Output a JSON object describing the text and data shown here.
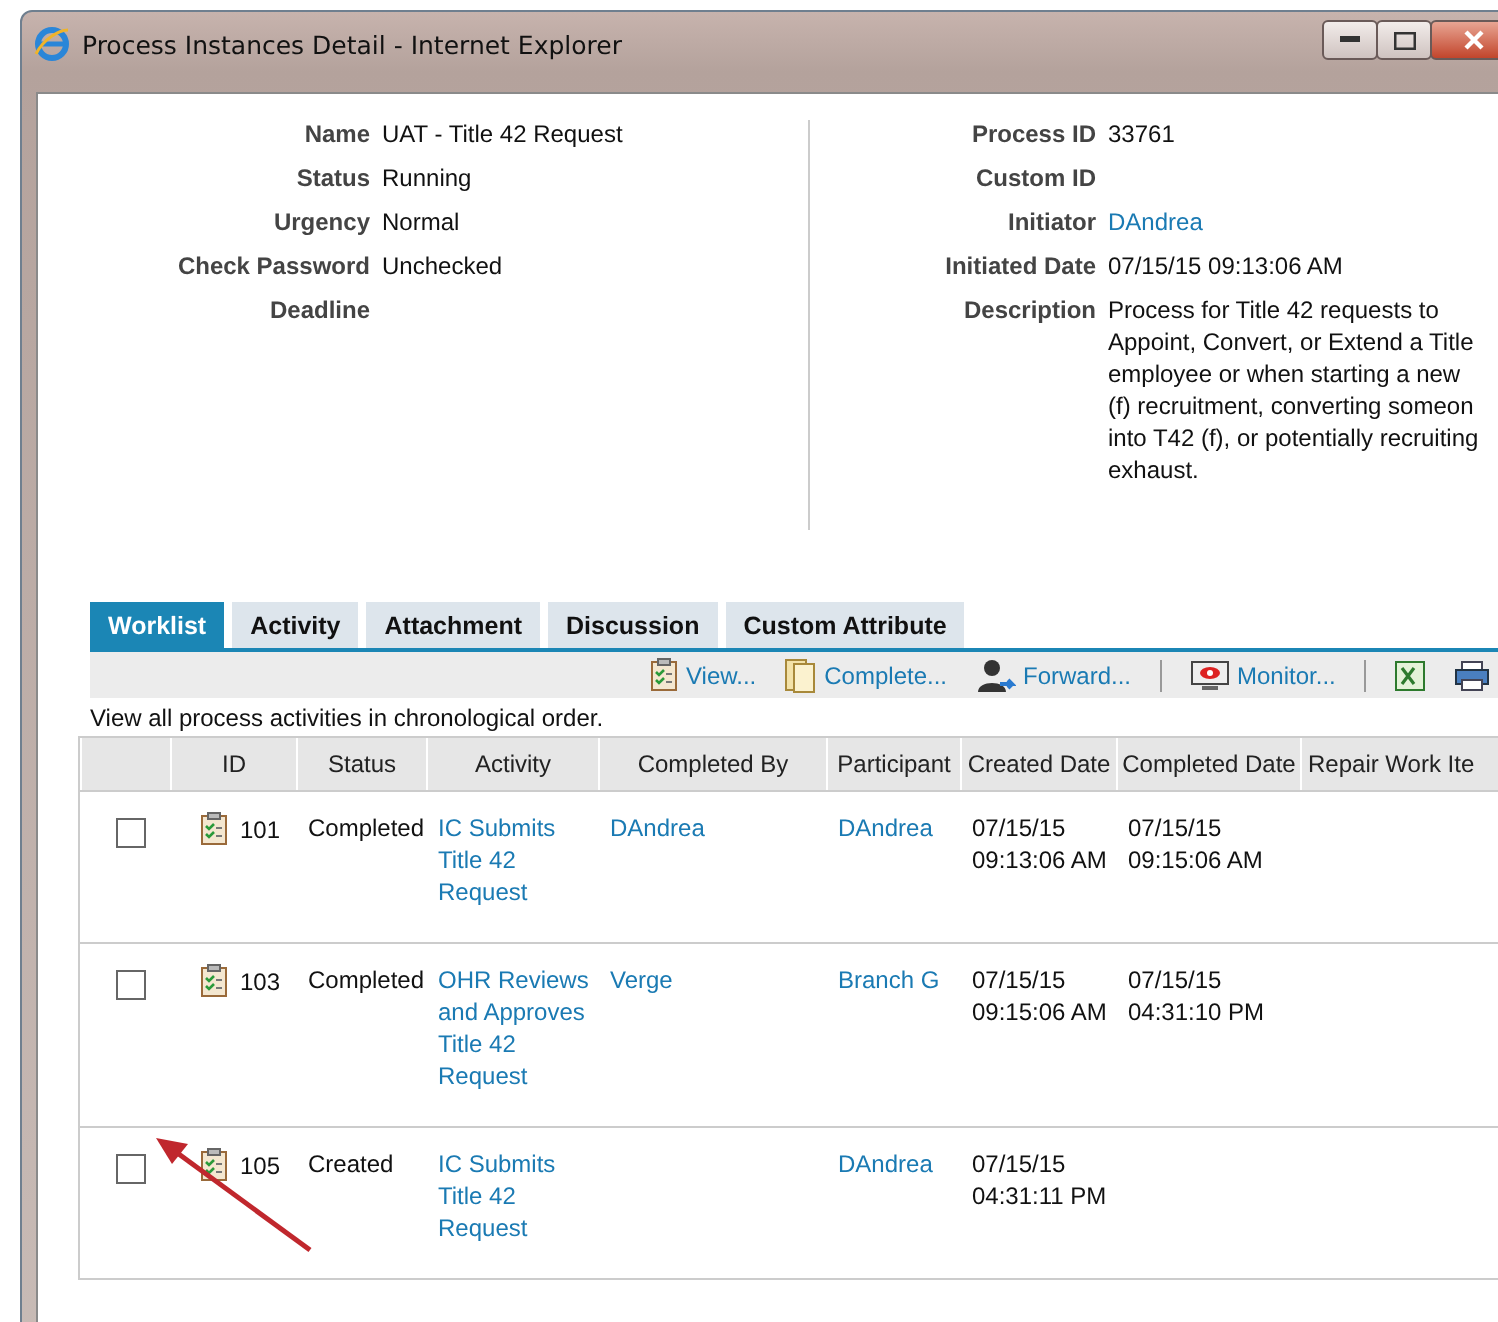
{
  "window": {
    "title": "Process Instances Detail - Internet Explorer"
  },
  "details_left": [
    {
      "label": "Name",
      "value": "UAT - Title 42 Request"
    },
    {
      "label": "Status",
      "value": "Running"
    },
    {
      "label": "Urgency",
      "value": "Normal"
    },
    {
      "label": "Check Password",
      "value": "Unchecked"
    },
    {
      "label": "Deadline"
    }
  ],
  "details_right": [
    {
      "label": "Process ID",
      "value": "33761"
    },
    {
      "label": "Custom ID"
    },
    {
      "label": "Initiator",
      "value": "DAndrea",
      "kind": "link"
    },
    {
      "label": "Initiated Date",
      "value": "07/15/15 09:13:06 AM"
    },
    {
      "label": "Description",
      "kind": "lines",
      "lines": [
        "Process for Title 42 requests to",
        "Appoint, Convert, or Extend a Title",
        "employee or when starting a new",
        "(f) recruitment, converting someon",
        "into T42 (f), or potentially recruiting",
        "exhaust."
      ]
    }
  ],
  "tabs": [
    {
      "label": "Worklist",
      "selected": true
    },
    {
      "label": "Activity",
      "selected": false
    },
    {
      "label": "Attachment",
      "selected": false
    },
    {
      "label": "Discussion",
      "selected": false
    },
    {
      "label": "Custom Attribute",
      "selected": false
    }
  ],
  "toolbar": [
    {
      "kind": "view",
      "label": "View..."
    },
    {
      "kind": "complete",
      "label": "Complete..."
    },
    {
      "kind": "forward",
      "label": "Forward..."
    },
    {
      "kind": "separator"
    },
    {
      "kind": "monitor",
      "label": "Monitor..."
    },
    {
      "kind": "separator"
    },
    {
      "kind": "excel"
    },
    {
      "kind": "print"
    }
  ],
  "hint": "View all process activities in chronological order.",
  "table": {
    "columns": [
      "ID",
      "Status",
      "Activity",
      "Completed By",
      "Participant",
      "Created Date",
      "Completed Date",
      "Repair Work Ite"
    ],
    "rows": [
      {
        "checked": false,
        "id": "101",
        "status": "Completed",
        "activity": "IC Submits Title 42 Request",
        "completed_by": "DAndrea",
        "participant": "DAndrea",
        "created": "07/15/15 09:13:06 AM",
        "completed": "07/15/15 09:15:06 AM"
      },
      {
        "checked": false,
        "id": "103",
        "status": "Completed",
        "activity": "OHR Reviews and Approves Title 42 Request",
        "completed_by": "Verge",
        "participant": "Branch G",
        "created": "07/15/15 09:15:06 AM",
        "completed": "07/15/15 04:31:10 PM"
      },
      {
        "checked": false,
        "id": "105",
        "status": "Created",
        "activity": "IC Submits Title 42 Request",
        "participant": "DAndrea",
        "created": "07/15/15 04:31:11 PM"
      }
    ]
  },
  "annotation": {
    "kind": "arrow"
  }
}
